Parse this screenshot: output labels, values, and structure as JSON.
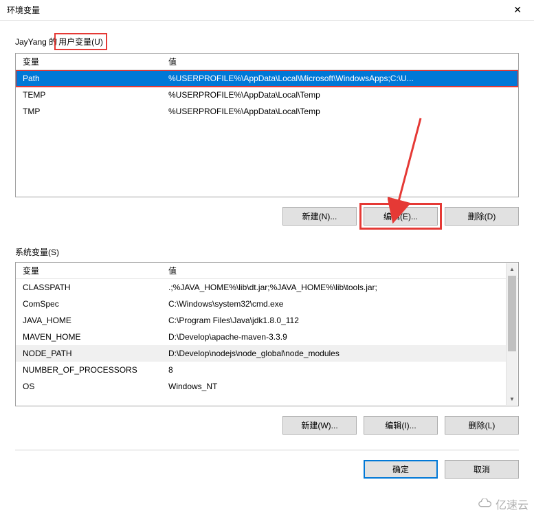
{
  "dialog": {
    "title": "环境变量"
  },
  "user_section": {
    "label_prefix": "JayYang 的",
    "label_boxed": "用户变量(U)",
    "columns": {
      "variable": "变量",
      "value": "值"
    },
    "rows": [
      {
        "name": "Path",
        "value": "%USERPROFILE%\\AppData\\Local\\Microsoft\\WindowsApps;C:\\U...",
        "selected": true
      },
      {
        "name": "TEMP",
        "value": "%USERPROFILE%\\AppData\\Local\\Temp",
        "selected": false
      },
      {
        "name": "TMP",
        "value": "%USERPROFILE%\\AppData\\Local\\Temp",
        "selected": false
      }
    ],
    "buttons": {
      "new": "新建(N)...",
      "edit": "编辑(E)...",
      "delete": "删除(D)"
    }
  },
  "system_section": {
    "label": "系统变量(S)",
    "columns": {
      "variable": "变量",
      "value": "值"
    },
    "rows": [
      {
        "name": "CLASSPATH",
        "value": ".;%JAVA_HOME%\\lib\\dt.jar;%JAVA_HOME%\\lib\\tools.jar;"
      },
      {
        "name": "ComSpec",
        "value": "C:\\Windows\\system32\\cmd.exe"
      },
      {
        "name": "JAVA_HOME",
        "value": "C:\\Program Files\\Java\\jdk1.8.0_112"
      },
      {
        "name": "MAVEN_HOME",
        "value": "D:\\Develop\\apache-maven-3.3.9"
      },
      {
        "name": "NODE_PATH",
        "value": "D:\\Develop\\nodejs\\node_global\\node_modules"
      },
      {
        "name": "NUMBER_OF_PROCESSORS",
        "value": "8"
      },
      {
        "name": "OS",
        "value": "Windows_NT"
      }
    ],
    "buttons": {
      "new": "新建(W)...",
      "edit": "编辑(I)...",
      "delete": "删除(L)"
    }
  },
  "bottom": {
    "ok": "确定",
    "cancel": "取消"
  },
  "watermark": "亿速云"
}
